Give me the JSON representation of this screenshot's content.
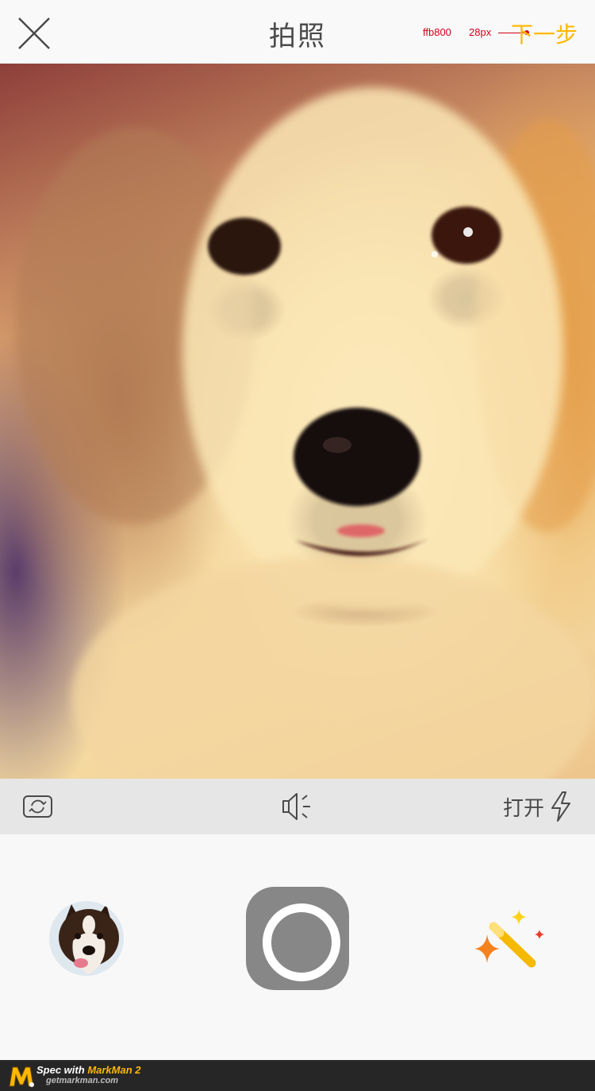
{
  "header": {
    "title": "拍照",
    "next_label": "下一步",
    "spec_color": "ffb800",
    "spec_size": "28px",
    "accent_color": "#ffb800"
  },
  "toolbar": {
    "flash_label": "打开"
  },
  "footer": {
    "spec_with": "Spec with",
    "brand": "MarkMan 2",
    "site": "getmarkman.com"
  },
  "icons": {
    "close": "close-icon",
    "switch_camera": "switch-camera-icon",
    "sound": "speaker-icon",
    "flash": "lightning-icon",
    "magic": "magic-wand-icon"
  }
}
